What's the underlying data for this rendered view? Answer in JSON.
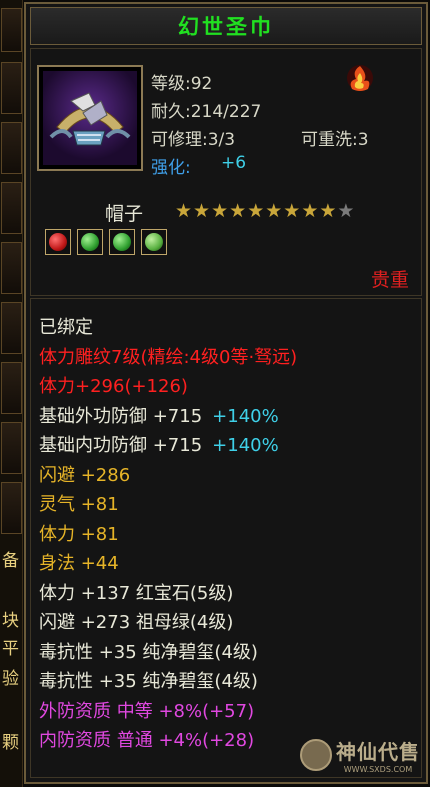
{
  "side_chars": [
    "备",
    "块",
    "平",
    "验",
    "颗"
  ],
  "item": {
    "name": "幻世圣巾",
    "icon": "headband-item-icon",
    "level": "等级:92",
    "durability": "耐久:214/227",
    "repair": "可修理:3/3",
    "rewash": "可重洗:3",
    "enhance_label": "强化:",
    "enhance_value": "+6",
    "type": "帽子",
    "stars_filled": 9,
    "stars_total": 10,
    "quality": "贵重",
    "gems": [
      "red-gem",
      "green-gem",
      "green-gem",
      "green-gem"
    ]
  },
  "stats": [
    {
      "segments": [
        {
          "text": "已绑定",
          "color": "#e8e8d8"
        }
      ]
    },
    {
      "segments": [
        {
          "text": "体力雕纹7级(精绘:4级0等·驽远)",
          "color": "#ff2020"
        }
      ]
    },
    {
      "segments": [
        {
          "text": "体力+296(+126)",
          "color": "#ff2020"
        }
      ]
    },
    {
      "segments": [
        {
          "text": "基础外功防御 +715",
          "color": "#e8e8d8"
        },
        {
          "text": "+140%",
          "color": "#3fd0e8"
        }
      ]
    },
    {
      "segments": [
        {
          "text": "基础内功防御 +715",
          "color": "#e8e8d8"
        },
        {
          "text": "+140%",
          "color": "#3fd0e8"
        }
      ]
    },
    {
      "segments": [
        {
          "text": "闪避 +286",
          "color": "#e6b428"
        }
      ]
    },
    {
      "segments": [
        {
          "text": "灵气 +81",
          "color": "#e6b428"
        }
      ]
    },
    {
      "segments": [
        {
          "text": "体力 +81",
          "color": "#e6b428"
        }
      ]
    },
    {
      "segments": [
        {
          "text": "身法 +44",
          "color": "#e6b428"
        }
      ]
    },
    {
      "segments": [
        {
          "text": "体力 +137 红宝石(5级)",
          "color": "#e8e8d8"
        }
      ]
    },
    {
      "segments": [
        {
          "text": "闪避 +273 祖母绿(4级)",
          "color": "#e8e8d8"
        }
      ]
    },
    {
      "segments": [
        {
          "text": "毒抗性 +35 纯净碧玺(4级)",
          "color": "#e8e8d8"
        }
      ]
    },
    {
      "segments": [
        {
          "text": "毒抗性 +35 纯净碧玺(4级)",
          "color": "#e8e8d8"
        }
      ]
    },
    {
      "segments": [
        {
          "text": "外防资质 中等 +8%(+57)",
          "color": "#e048e0"
        }
      ]
    },
    {
      "segments": [
        {
          "text": "内防资质 普通 +4%(+28)",
          "color": "#e048e0"
        }
      ]
    }
  ],
  "watermark": {
    "cn": "神仙代售",
    "url": "WWW.SXDS.COM"
  }
}
